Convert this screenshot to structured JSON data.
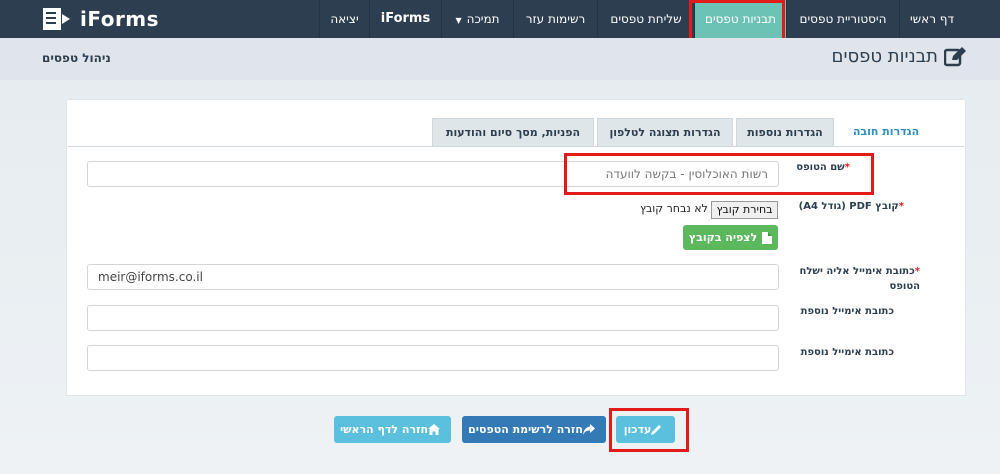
{
  "brand": {
    "name": "iForms"
  },
  "nav": {
    "home": "דף ראשי",
    "history": "היסטוריית טפסים",
    "templates": "תבניות טפסים",
    "send": "שליחת טפסים",
    "lists": "רשימות עזר",
    "support": "תמיכה",
    "iforms": "iForms",
    "logout": "יציאה"
  },
  "page": {
    "title": "תבניות טפסים",
    "breadcrumb": "ניהול טפסים"
  },
  "tabs": {
    "required": "הגדרות חובה",
    "extra": "הגדרות נוספות",
    "phone": "הגדרות תצוגה לטלפון",
    "redirect": "הפניות, מסך סיום והודעות"
  },
  "form": {
    "name_label": "שם הטופס",
    "name_value": "רשות האוכלוסין - בקשה לוועדה",
    "pdf_label": "קובץ PDF (גודל A4)",
    "file_button": "בחירת קובץ",
    "file_none": "לא נבחר קובץ",
    "view_file": "לצפיה בקובץ",
    "email_label": "כתובת אימייל אליה ישלח הטופס",
    "email_value": "meir@iforms.co.il",
    "extra_email_label_1": "כתובת אימייל נוספת",
    "extra_email_label_2": "כתובת אימייל נוספת",
    "required_mark": "*"
  },
  "actions": {
    "update": "עדכון",
    "back_list": "חזרה לרשימת הטפסים",
    "back_home": "חזרה לדף הראשי"
  },
  "colors": {
    "navbar": "#2c3e50",
    "active_tab": "#6cc2b5",
    "highlight": "#e21a1a"
  }
}
